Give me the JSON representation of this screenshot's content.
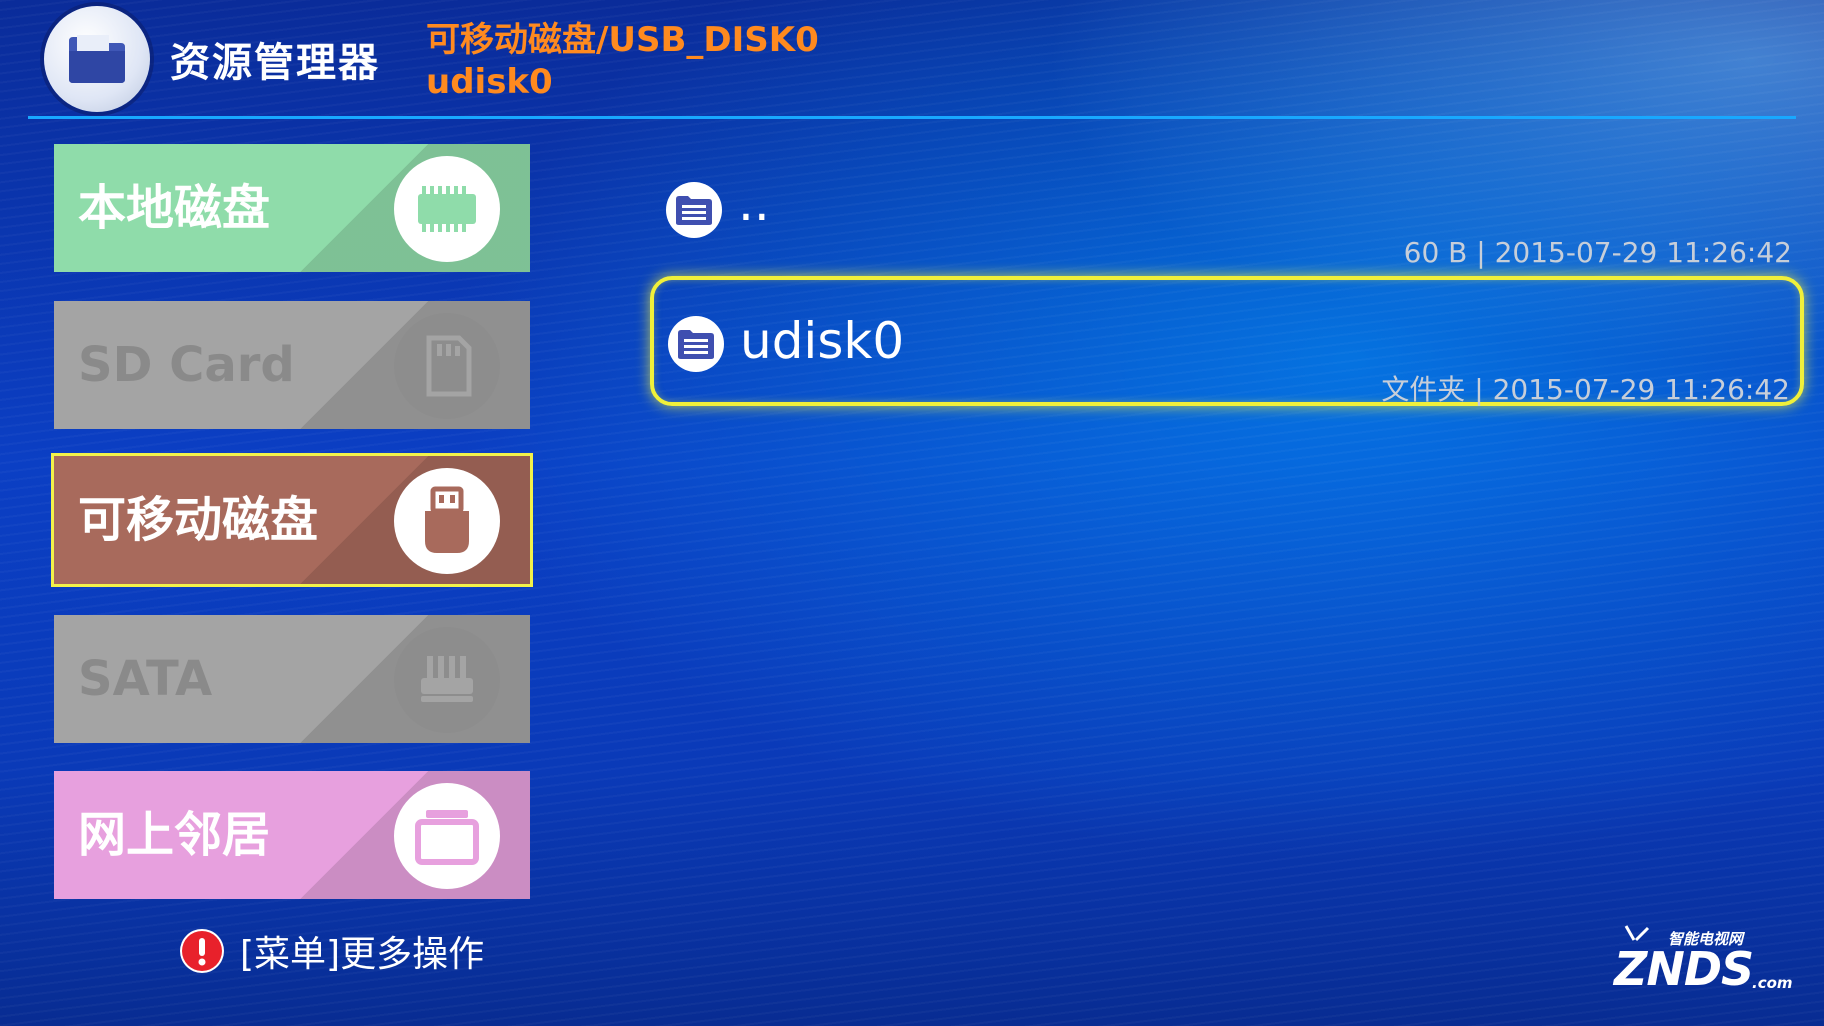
{
  "header": {
    "app_title": "资源管理器",
    "path": "可移动磁盘/USB_DISK0",
    "current_folder": "udisk0"
  },
  "sidebar": {
    "items": [
      {
        "label": "本地磁盘",
        "icon": "memory-chip-icon",
        "state": "enabled"
      },
      {
        "label": "SD Card",
        "icon": "sd-card-icon",
        "state": "disabled"
      },
      {
        "label": "可移动磁盘",
        "icon": "usb-drive-icon",
        "state": "selected"
      },
      {
        "label": "SATA",
        "icon": "sata-connector-icon",
        "state": "disabled"
      },
      {
        "label": "网上邻居",
        "icon": "network-monitor-icon",
        "state": "enabled"
      }
    ],
    "menu_hint": "[菜单]更多操作"
  },
  "files": [
    {
      "name": "..",
      "meta": "60 B | 2015-07-29 11:26:42",
      "icon": "folder-doc-icon",
      "selected": false
    },
    {
      "name": "udisk0",
      "meta": "文件夹 | 2015-07-29 11:26:42",
      "icon": "folder-doc-icon",
      "selected": true
    }
  ],
  "watermark": {
    "top_text": "智能电视网",
    "brand": "ZNDS",
    "suffix": ".com"
  },
  "colors": {
    "accent_path": "#ff8a1f",
    "selection_border": "#f0f03a",
    "divider": "#18a8ff",
    "local_disk": "#8fdcaa",
    "removable_disk": "#a86a5c",
    "network": "#e7a0de",
    "disabled": "#a4a4a4"
  }
}
